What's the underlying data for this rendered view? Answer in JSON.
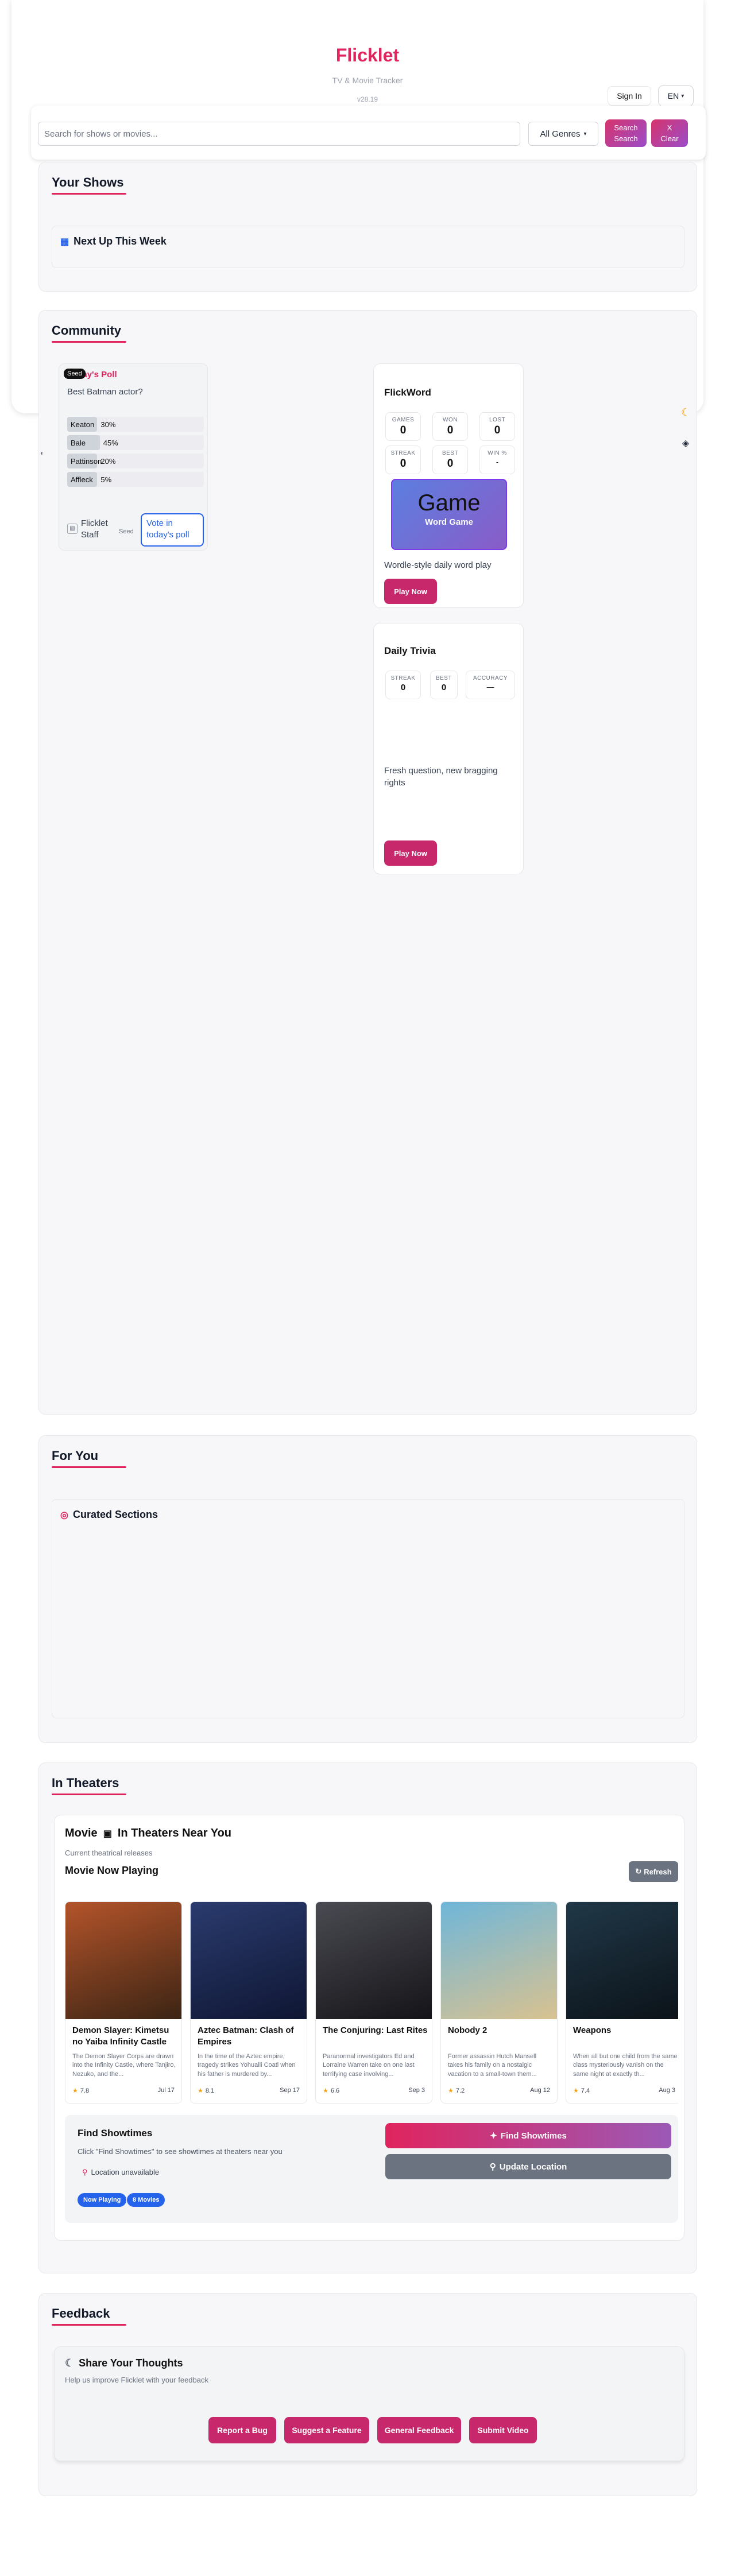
{
  "header": {
    "brand": "Flicklet",
    "tagline": "TV & Movie Tracker",
    "version": "v28.19",
    "signin_label": "Sign In",
    "language": "EN"
  },
  "search": {
    "placeholder": "Search for shows or movies...",
    "genre_selected": "All Genres",
    "search_label_1": "Search",
    "search_label_2": "Search",
    "clear_label_1": "X",
    "clear_label_2": "Clear"
  },
  "your_shows": {
    "title": "Your Shows",
    "next_up_icon": "calendar-icon",
    "next_up_title": "Next Up This Week"
  },
  "community": {
    "title": "Community",
    "poll": {
      "seed_badge": "Seed",
      "title": "Today's Poll",
      "question": "Best Batman actor?",
      "options": [
        {
          "name": "Keaton",
          "pct_label": "30%",
          "pct": 30
        },
        {
          "name": "Bale",
          "pct_label": "45%",
          "pct": 45
        },
        {
          "name": "Pattinson",
          "pct_label": "20%",
          "pct": 20
        },
        {
          "name": "Affleck",
          "pct_label": "5%",
          "pct": 5
        }
      ],
      "author": "Flicklet Staff",
      "author_seed": "Seed",
      "vote_label": "Vote in today's poll"
    },
    "flickword": {
      "title": "FlickWord",
      "stats": [
        {
          "label": "GAMES",
          "value": "0"
        },
        {
          "label": "WON",
          "value": "0"
        },
        {
          "label": "LOST",
          "value": "0"
        },
        {
          "label": "STREAK",
          "value": "0"
        },
        {
          "label": "BEST",
          "value": "0"
        },
        {
          "label": "WIN %",
          "value": "-"
        }
      ],
      "tile_big": "Game",
      "tile_small": "Word Game",
      "description": "Wordle-style daily word play",
      "play_label": "Play Now"
    },
    "trivia": {
      "title": "Daily Trivia",
      "stats": [
        {
          "label": "STREAK",
          "value": "0"
        },
        {
          "label": "BEST",
          "value": "0"
        },
        {
          "label": "ACCURACY",
          "value": "—"
        }
      ],
      "description": "Fresh question, new bragging rights",
      "play_label": "Play Now"
    }
  },
  "for_you": {
    "title": "For You",
    "curated_icon": "target-icon",
    "curated_title": "Curated Sections"
  },
  "in_theaters": {
    "title": "In Theaters",
    "card_prefix": "Movie",
    "card_icon": "film-icon",
    "card_title": "In Theaters Near You",
    "card_subtitle": "Current theatrical releases",
    "now_playing": "Movie Now Playing",
    "refresh_label": "Refresh",
    "movies": [
      {
        "title": "Demon Slayer: Kimetsu no Yaiba Infinity Castle",
        "desc": "The Demon Slayer Corps are drawn into the Infinity Castle, where Tanjiro, Nezuko, and the...",
        "rating": "7.8",
        "date": "Jul 17",
        "poster_a": "#b4542a",
        "poster_b": "#3b2414"
      },
      {
        "title": "Aztec Batman: Clash of Empires",
        "desc": "In the time of the Aztec empire, tragedy strikes Yohualli Coatl when his father is murdered by...",
        "rating": "8.1",
        "date": "Sep 17",
        "poster_a": "#2a3b6e",
        "poster_b": "#0f1633"
      },
      {
        "title": "The Conjuring: Last Rites",
        "desc": "Paranormal investigators Ed and Lorraine Warren take on one last terrifying case involving...",
        "rating": "6.6",
        "date": "Sep 3",
        "poster_a": "#4a4a52",
        "poster_b": "#141418"
      },
      {
        "title": "Nobody 2",
        "desc": "Former assassin Hutch Mansell takes his family on a nostalgic vacation to a small-town them...",
        "rating": "7.2",
        "date": "Aug 12",
        "poster_a": "#6fb6d9",
        "poster_b": "#d9c290"
      },
      {
        "title": "Weapons",
        "desc": "When all but one child from the same class mysteriously vanish on the same night at exactly th...",
        "rating": "7.4",
        "date": "Aug 3",
        "poster_a": "#203848",
        "poster_b": "#0b1218"
      }
    ],
    "showtimes": {
      "title": "Find Showtimes",
      "desc": "Click \"Find Showtimes\" to see showtimes at theaters near you",
      "location": "Location unavailable",
      "pill_1": "Now Playing",
      "pill_2": "8 Movies",
      "find_label": "Find Showtimes",
      "update_label": "Update Location"
    }
  },
  "feedback": {
    "title": "Feedback",
    "card_icon": "moon-icon",
    "card_title": "Share Your Thoughts",
    "card_subtitle": "Help us improve Flicklet with your feedback",
    "buttons": [
      "Report a Bug",
      "Suggest a Feature",
      "General Feedback",
      "Submit Video"
    ]
  },
  "colors": {
    "brand": "#e0245e",
    "play_button": "#c7286c",
    "pill": "#2563eb"
  }
}
